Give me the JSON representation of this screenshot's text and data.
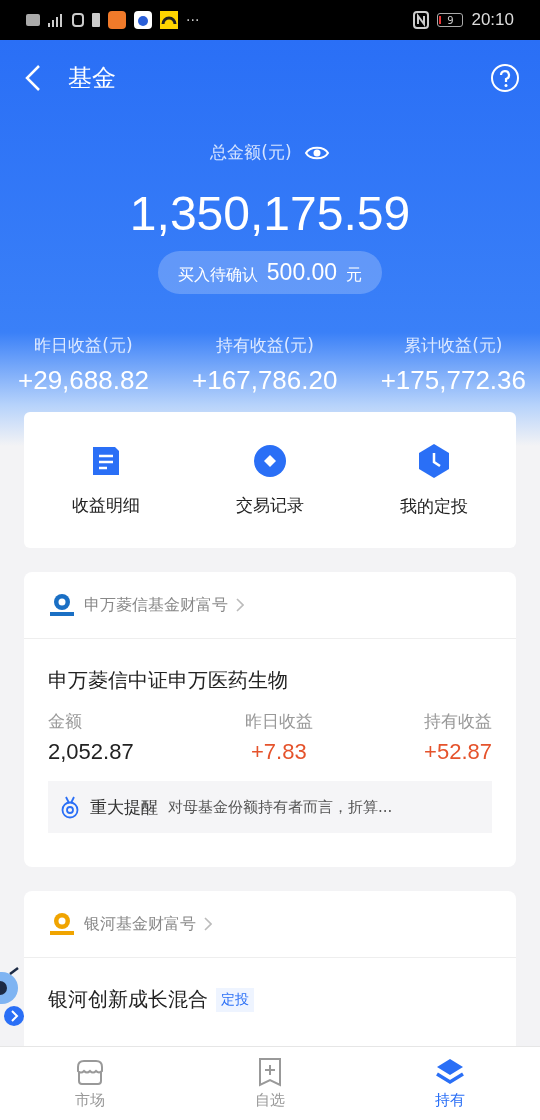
{
  "status_bar": {
    "more": "···",
    "battery": "9",
    "time": "20:10"
  },
  "header": {
    "title": "基金"
  },
  "summary": {
    "label": "总金额(元)",
    "total": "1,350,175.59",
    "pending_label": "买入待确认",
    "pending_amount": "500.00",
    "pending_unit": "元"
  },
  "stats": [
    {
      "label": "昨日收益(元)",
      "value": "+29,688.82"
    },
    {
      "label": "持有收益(元)",
      "value": "+167,786.20"
    },
    {
      "label": "累计收益(元)",
      "value": "+175,772.36"
    }
  ],
  "actions": [
    {
      "kind": "doc",
      "label": "收益明细"
    },
    {
      "kind": "diamond",
      "label": "交易记录"
    },
    {
      "kind": "clock",
      "label": "我的定投"
    }
  ],
  "holdings": [
    {
      "provider": "申万菱信基金财富号",
      "color": "#1a6fc4",
      "name": "申万菱信中证申万医药生物",
      "stats": [
        {
          "label": "金额",
          "value": "2,052.87",
          "kind": "plain"
        },
        {
          "label": "昨日收益",
          "value": "+7.83",
          "kind": "gain"
        },
        {
          "label": "持有收益",
          "value": "+52.87",
          "kind": "gain"
        }
      ],
      "notice": {
        "title": "重大提醒",
        "text": "对母基金份额持有者而言，折算..."
      }
    },
    {
      "provider": "银河基金财富号",
      "color": "#f0a400",
      "name": "银河创新成长混合",
      "tag": "定投"
    }
  ],
  "tabs": [
    {
      "kind": "market",
      "label": "市场",
      "selected": false
    },
    {
      "kind": "watch",
      "label": "自选",
      "selected": false
    },
    {
      "kind": "hold",
      "label": "持有",
      "selected": true
    }
  ]
}
